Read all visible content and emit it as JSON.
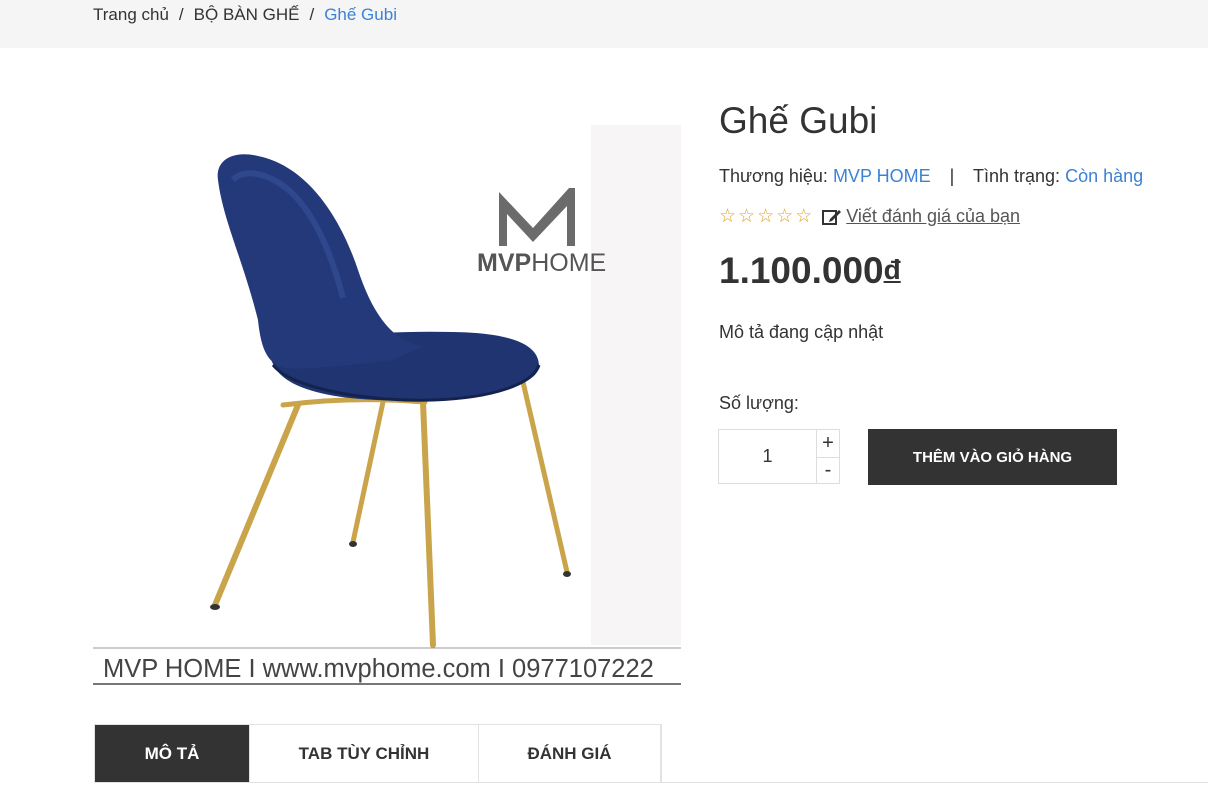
{
  "breadcrumb": {
    "home": "Trang chủ",
    "category": "BỘ BÀN GHẾ",
    "current": "Ghế Gubi",
    "separator": "/"
  },
  "product": {
    "title": "Ghế Gubi",
    "brand_label": "Thương hiệu:",
    "brand": "MVP HOME",
    "status_label": "Tình trạng:",
    "status": "Còn hàng",
    "rating_stars": 0,
    "rating_max": 5,
    "review_link": "Viết đánh giá của bạn",
    "price": "1.100.000",
    "currency": "đ",
    "description": "Mô tả đang cập nhật",
    "quantity_label": "Số lượng:",
    "quantity": "1",
    "plus": "+",
    "minus": "-",
    "add_to_cart": "THÊM VÀO GIỎ HÀNG"
  },
  "image": {
    "logo_text_bold": "MVP",
    "logo_text_light": "HOME",
    "footer_text": "MVP HOME I www.mvphome.com I 0977107222",
    "seat_color": "#1f3470",
    "leg_color": "#c9a44a"
  },
  "tabs": [
    {
      "label": "MÔ TẢ",
      "active": true
    },
    {
      "label": "TAB TÙY CHỈNH",
      "active": false
    },
    {
      "label": "ĐÁNH GIÁ",
      "active": false
    }
  ],
  "colors": {
    "accent": "#3b82d6",
    "star": "#e0a12a",
    "dark": "#333333"
  }
}
